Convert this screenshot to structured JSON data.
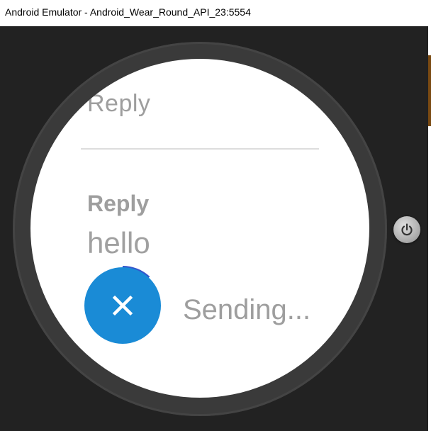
{
  "window": {
    "title": "Android Emulator - Android_Wear_Round_API_23:5554"
  },
  "watch": {
    "reply_top_label": "Reply",
    "reply_label": "Reply",
    "reply_message": "hello",
    "status_text": "Sending...",
    "send_progress": 0.12,
    "cancel_icon": "close-icon",
    "accent_color": "#1a8bd6",
    "progress_color": "#3355cc"
  },
  "emulator": {
    "power_icon": "power-icon"
  }
}
